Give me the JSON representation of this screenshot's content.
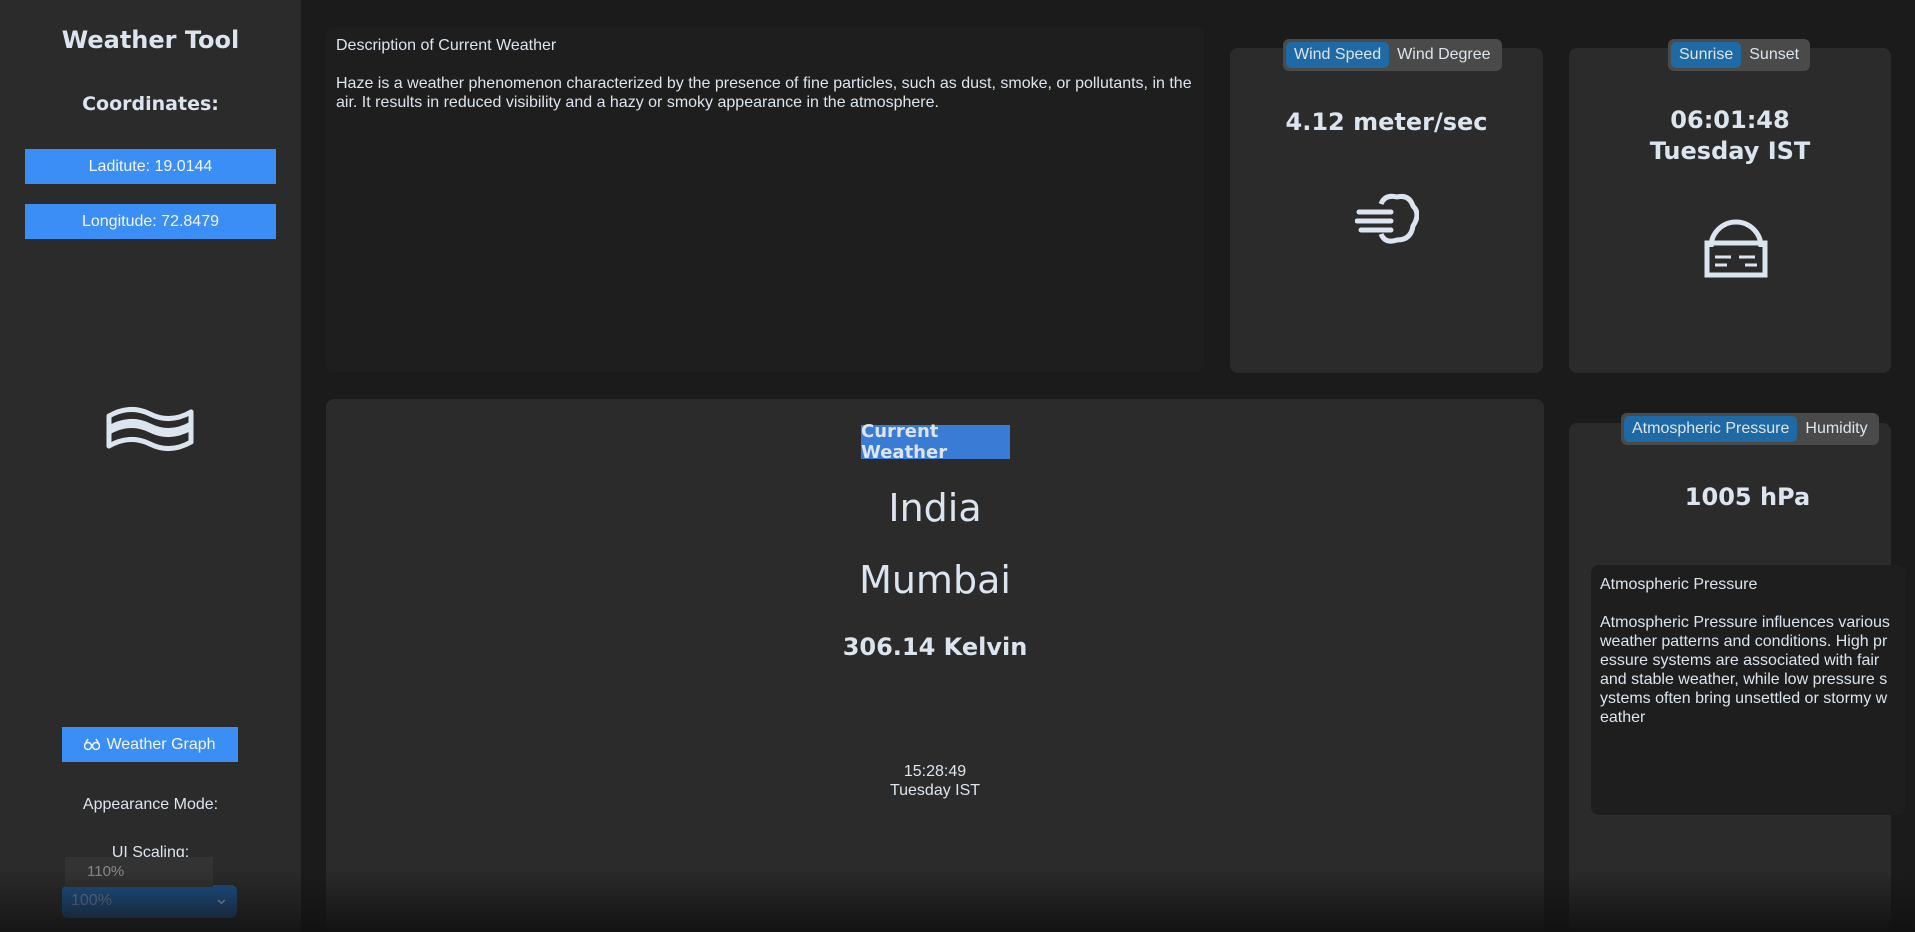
{
  "app": {
    "title": "Weather Tool",
    "coordinates_heading": "Coordinates:"
  },
  "sidebar": {
    "latitude_label": "Laditute: 19.0144",
    "longitude_label": "Longitude: 72.8479",
    "current_icon": "haze-waves-icon",
    "graph_button_label": "Weather Graph",
    "graph_button_icon": "chart-icon",
    "appearance_label": "Appearance Mode:",
    "scaling_label": "UI Scaling:",
    "scaling_popup_option": "110%",
    "scaling_selected": "100%"
  },
  "description": {
    "heading": "Description of Current Weather",
    "text": "Haze is a weather phenomenon characterized by the presence of fine particles, such as dust, smoke, or pollutants, in the air. It results in reduced visibility and a hazy or smoky appearance in the atmosphere."
  },
  "wind": {
    "tabs": [
      "Wind Speed",
      "Wind Degree"
    ],
    "active_tab": 0,
    "value": "4.12 meter/sec",
    "icon": "wind-icon"
  },
  "sun": {
    "tabs": [
      "Sunrise",
      "Sunset"
    ],
    "active_tab": 0,
    "time": "06:01:48",
    "day": "Tuesday IST",
    "icon": "sunrise-icon"
  },
  "current": {
    "heading": "Current Weather",
    "country": "India",
    "city": "Mumbai",
    "temperature": "306.14 Kelvin",
    "time": "15:28:49",
    "day": "Tuesday IST"
  },
  "pressure": {
    "tabs": [
      "Atmospheric Pressure",
      "Humidity"
    ],
    "active_tab": 0,
    "value": "1005 hPa",
    "info_heading": "Atmospheric Pressure",
    "info_text": "Atmospheric Pressure influences various weather patterns and conditions. High pressure systems are associated with fair and stable weather, while low pressure systems often bring unsettled or stormy weather"
  },
  "colors": {
    "accent": "#3a8ef6",
    "segment_active": "#1f6aa5",
    "panel": "#2b2b2b",
    "background": "#1b1b1b",
    "text": "#dce4ee"
  }
}
